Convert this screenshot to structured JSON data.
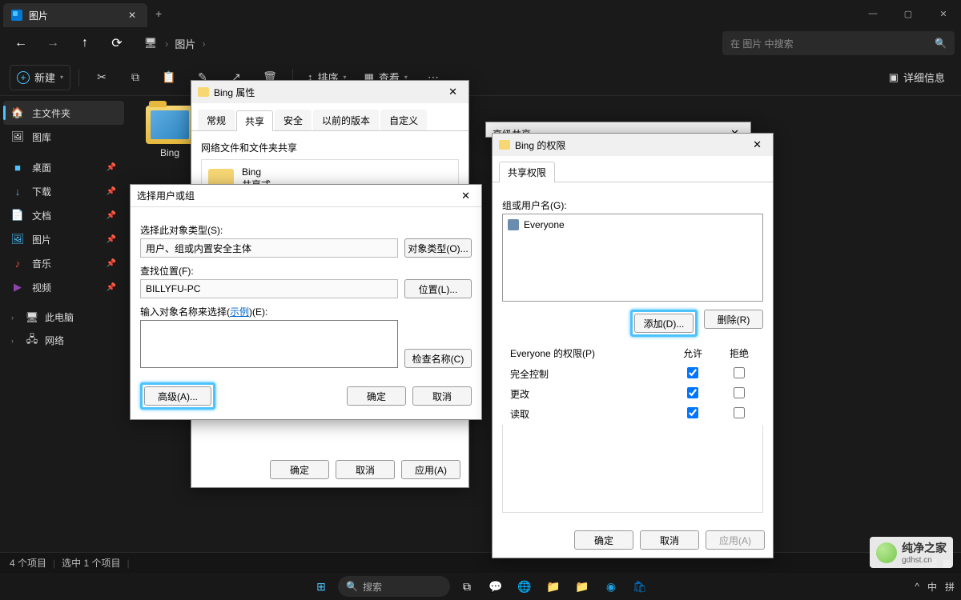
{
  "tab": {
    "title": "图片"
  },
  "window_controls": {
    "min": "—",
    "max": "▢",
    "close": "✕"
  },
  "breadcrumb": {
    "item": "图片"
  },
  "search": {
    "placeholder": "在 图片 中搜索"
  },
  "toolbar": {
    "new": "新建",
    "sort": "排序",
    "view": "查看",
    "details": "详细信息"
  },
  "sidebar": {
    "home": "主文件夹",
    "gallery": "图库",
    "desktop": "桌面",
    "downloads": "下载",
    "documents": "文档",
    "pictures": "图片",
    "music": "音乐",
    "videos": "视频",
    "thispc": "此电脑",
    "network": "网络"
  },
  "folder": {
    "name": "Bing"
  },
  "status": {
    "count": "4 个项目",
    "selected": "选中 1 个项目"
  },
  "properties_dialog": {
    "title": "Bing 属性",
    "tabs": {
      "general": "常规",
      "sharing": "共享",
      "security": "安全",
      "previous": "以前的版本",
      "custom": "自定义"
    },
    "section": "网络文件和文件夹共享",
    "folder_name": "Bing",
    "share_status": "共享式",
    "ok": "确定",
    "cancel": "取消",
    "apply": "应用(A)"
  },
  "adv_share_dialog": {
    "title": "高级共享"
  },
  "select_user_dialog": {
    "title": "选择用户或组",
    "obj_type_label": "选择此对象类型(S):",
    "obj_type_value": "用户、组或内置安全主体",
    "obj_type_btn": "对象类型(O)...",
    "location_label": "查找位置(F):",
    "location_value": "BILLYFU-PC",
    "location_btn": "位置(L)...",
    "names_label_pre": "输入对象名称来选择(",
    "names_label_link": "示例",
    "names_label_post": ")(E):",
    "check_btn": "检查名称(C)",
    "advanced_btn": "高级(A)...",
    "ok": "确定",
    "cancel": "取消"
  },
  "permissions_dialog": {
    "title": "Bing 的权限",
    "tab": "共享权限",
    "group_label": "组或用户名(G):",
    "everyone": "Everyone",
    "add_btn": "添加(D)...",
    "remove_btn": "删除(R)",
    "perm_header": "Everyone 的权限(P)",
    "allow": "允许",
    "deny": "拒绝",
    "rows": [
      {
        "label": "完全控制",
        "allow": true,
        "deny": false
      },
      {
        "label": "更改",
        "allow": true,
        "deny": false
      },
      {
        "label": "读取",
        "allow": true,
        "deny": false
      }
    ],
    "ok": "确定",
    "cancel": "取消",
    "apply": "应用(A)"
  },
  "taskbar": {
    "search": "搜索"
  },
  "tray": {
    "lang1": "中",
    "lang2": "拼"
  },
  "watermark": {
    "name": "纯净之家",
    "url": "gdhst.cn"
  }
}
